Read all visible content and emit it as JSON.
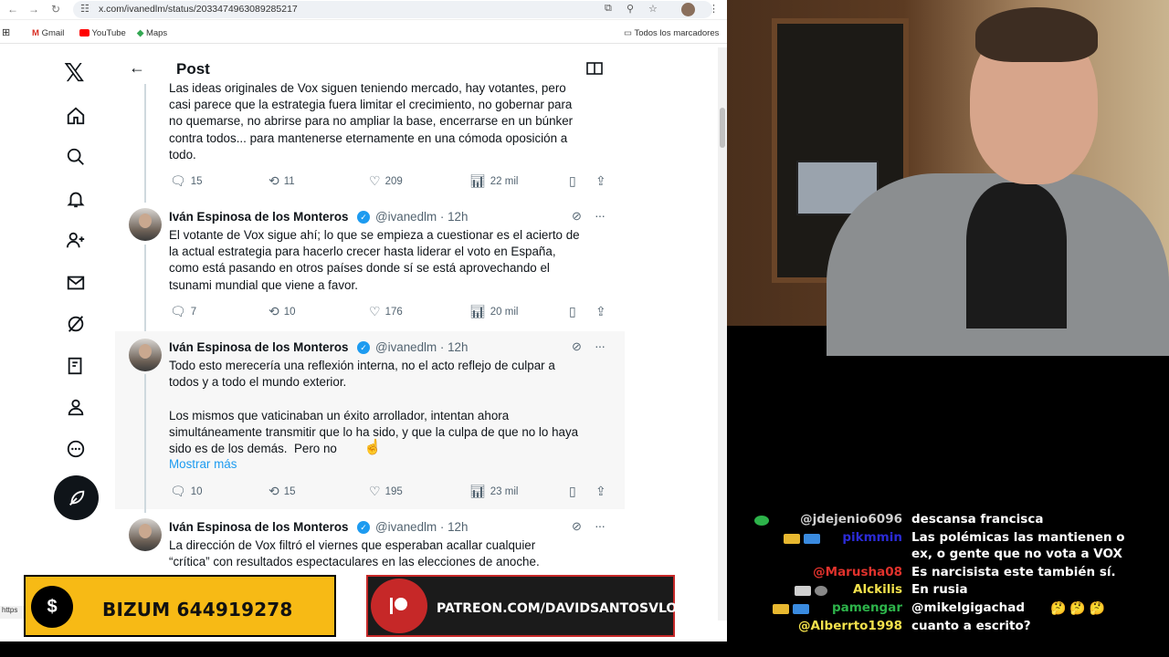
{
  "browser": {
    "url": "x.com/ivanedlm/status/2033474963089285217",
    "bookmarks": [
      {
        "label": "Gmail",
        "icon": "gmail-icon"
      },
      {
        "label": "YouTube",
        "icon": "youtube-icon"
      },
      {
        "label": "Maps",
        "icon": "maps-icon"
      }
    ],
    "all_bookmarks": "Todos los marcadores"
  },
  "page": {
    "title": "Post"
  },
  "tweets": [
    {
      "text": "Las ideas originales de Vox siguen teniendo mercado, hay votantes, pero\ncasi parece que la estrategia fuera limitar el crecimiento, no gobernar para\nno quemarse, no abrirse para no ampliar la base, encerrarse en un búnker\ncontra todos... para mantenerse eternamente en una cómoda oposición a\ntodo.",
      "replies": "15",
      "reposts": "11",
      "likes": "209",
      "views": "22 mil"
    },
    {
      "name": "Iván Espinosa de los Monteros",
      "handle": "@ivanedlm · 12h",
      "text": "El votante de Vox sigue ahí; lo que se empieza a cuestionar es el acierto de\nla actual estrategia para hacerlo crecer hasta liderar el voto en España,\ncomo está pasando en otros países donde sí se está aprovechando el\ntsunami mundial que viene a favor.",
      "replies": "7",
      "reposts": "10",
      "likes": "176",
      "views": "20 mil"
    },
    {
      "name": "Iván Espinosa de los Monteros",
      "handle": "@ivanedlm · 12h",
      "text": "Todo esto merecería una reflexión interna, no el acto reflejo de culpar a\ntodos y a todo el mundo exterior.\n\nLos mismos que vaticinaban un éxito arrollador, intentan ahora\nsimultáneamente transmitir que lo ha sido, y que la culpa de que no lo haya\nsido es de los demás.  Pero no",
      "show_more": "Mostrar más",
      "replies": "10",
      "reposts": "15",
      "likes": "195",
      "views": "23 mil"
    },
    {
      "name": "Iván Espinosa de los Monteros",
      "handle": "@ivanedlm · 12h",
      "text": "La dirección de Vox filtró el viernes que esperaban acallar cualquier\n“crítica” con resultados espectaculares en las elecciones de anoche."
    }
  ],
  "overlays": {
    "bizum": "BIZUM 644919278",
    "bizum_symbol": "$",
    "patreon": "PATREON.COM/DAVIDSANTOSVLOG"
  },
  "chat": [
    {
      "user": "@jdejenio6096",
      "color": "#cfcfcf",
      "msg": "descansa francisca"
    },
    {
      "user": "pikmmin",
      "color": "#2b2bd6",
      "msg": "Las polémicas las mantienen o"
    },
    {
      "user": "",
      "color": "#ffffff",
      "msg": "ex, o gente que no vota a VOX"
    },
    {
      "user": "@Marusha08",
      "color": "#e0322c",
      "msg": "Es narcisista este también sí."
    },
    {
      "user": "Alckilis",
      "color": "#f2e14c",
      "msg": "En rusia"
    },
    {
      "user": "pamengar",
      "color": "#2db34a",
      "msg": "@mikelgigachad"
    },
    {
      "user": "@Alberrto1998",
      "color": "#f2e14c",
      "msg": "cuanto a escrito?"
    }
  ],
  "colors": {
    "accent": "#1d9bf0",
    "bizum_bg": "#f7ba15",
    "patreon_border": "#c62828"
  }
}
